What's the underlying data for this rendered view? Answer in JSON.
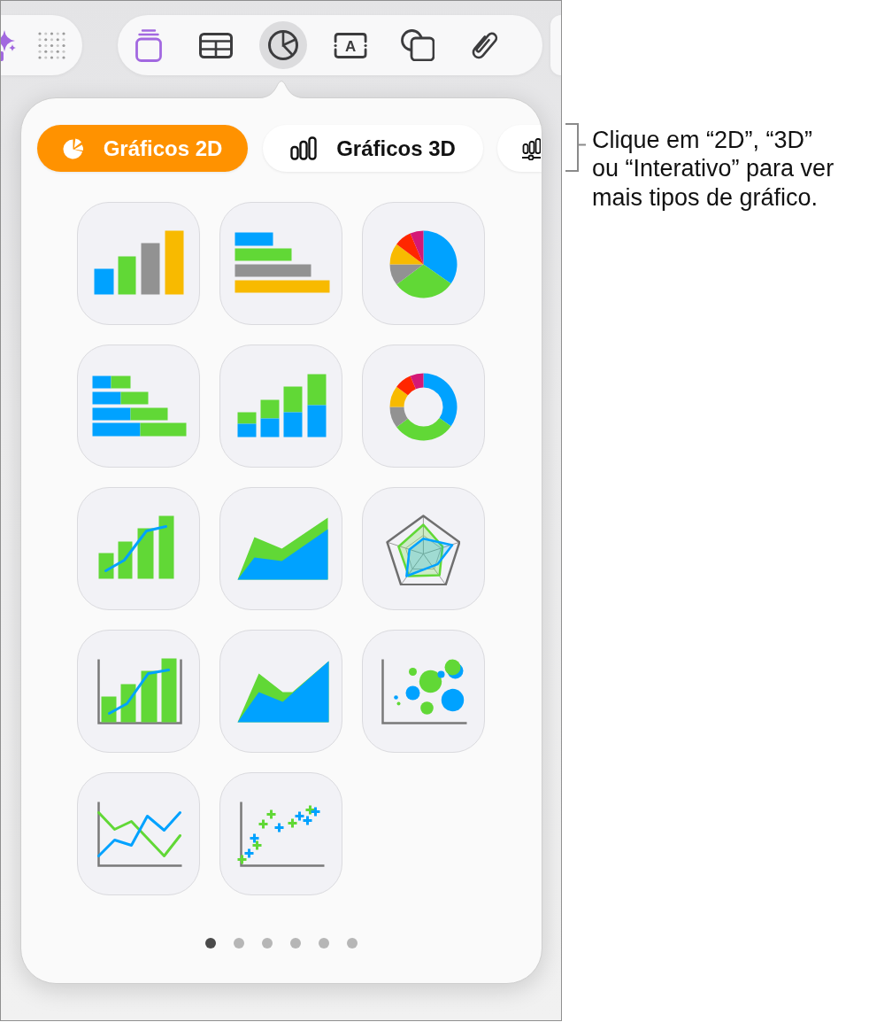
{
  "toolbar": {
    "items": [
      {
        "selected": false
      },
      {
        "selected": false
      },
      {
        "selected": true
      },
      {
        "selected": false,
        "glyph": "A"
      },
      {
        "selected": false
      },
      {
        "selected": false
      }
    ]
  },
  "popover": {
    "tabs": [
      {
        "label": "Gráficos 2D",
        "selected": true
      },
      {
        "label": "Gráficos 3D",
        "selected": false
      },
      {
        "selected": false
      }
    ],
    "chart_types": [
      {
        "kind": "column"
      },
      {
        "kind": "bar"
      },
      {
        "kind": "pie"
      },
      {
        "kind": "stacked-bar"
      },
      {
        "kind": "stacked-column"
      },
      {
        "kind": "donut"
      },
      {
        "kind": "column-line"
      },
      {
        "kind": "stacked-area"
      },
      {
        "kind": "radar"
      },
      {
        "kind": "dual-axis"
      },
      {
        "kind": "area"
      },
      {
        "kind": "bubble"
      },
      {
        "kind": "line"
      },
      {
        "kind": "scatter"
      }
    ],
    "page_dots": [
      {
        "selected": true
      },
      {
        "selected": false
      },
      {
        "selected": false
      },
      {
        "selected": false
      },
      {
        "selected": false
      },
      {
        "selected": false
      }
    ]
  },
  "callout": {
    "text": "Clique em “2D”, “3D”\nou “Interativo” para ver\nmais tipos de gráfico."
  }
}
